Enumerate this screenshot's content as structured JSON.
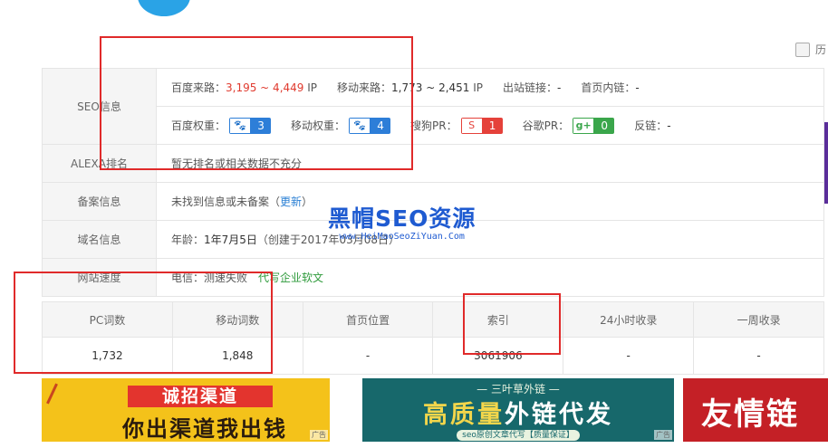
{
  "history_label": "历",
  "rows": {
    "seo": {
      "label": "SEO信息",
      "baidu_traffic_label": "百度来路：",
      "baidu_traffic_value": "3,195 ~ 4,449",
      "ip_unit": "IP",
      "mobile_traffic_label": "移动来路：",
      "mobile_traffic_value": "1,773 ~ 2,451",
      "outbound_links_label": "出站链接：",
      "outbound_links_value": "-",
      "home_internal_links_label": "首页内链：",
      "home_internal_links_value": "-",
      "baidu_weight_label": "百度权重：",
      "baidu_weight_value": "3",
      "mobile_weight_label": "移动权重：",
      "mobile_weight_value": "4",
      "sogou_pr_label": "搜狗PR：",
      "sogou_pr_value": "1",
      "google_pr_label": "谷歌PR：",
      "google_pr_value": "0",
      "backlinks_label": "反链：",
      "backlinks_value": "-"
    },
    "alexa": {
      "label": "ALEXA排名",
      "value": "暂无排名或相关数据不充分"
    },
    "icp": {
      "label": "备案信息",
      "value": "未找到信息或未备案（",
      "link": "更新",
      "close": "）"
    },
    "domain": {
      "label": "域名信息",
      "age_label": "年龄：",
      "age_value": "1年7月5日",
      "created": "（创建于2017年03月08日）"
    },
    "speed": {
      "label": "网站速度",
      "value": "电信：测速失败",
      "ad_link": "代写企业软文"
    }
  },
  "stats": {
    "headers": [
      "PC词数",
      "移动词数",
      "首页位置",
      "索引",
      "24小时收录",
      "一周收录"
    ],
    "values": [
      "1,732",
      "1,848",
      "-",
      "3061906",
      "-",
      "-"
    ]
  },
  "watermark": {
    "main": "黑帽SEO资源",
    "sub": "www.HeiMaoSeoZiYuan.Com"
  },
  "banners": {
    "ban1": {
      "tag": "诚招渠道",
      "slogan": "你出渠道我出钱",
      "ad": "广告"
    },
    "ban2": {
      "top": "— 三叶草外链 —",
      "main_a": "高质量",
      "main_b": "外链代发",
      "sub": "seo原创文章代写【质量保证】",
      "ad": "广告"
    },
    "ban3": {
      "text": "友情链"
    }
  }
}
